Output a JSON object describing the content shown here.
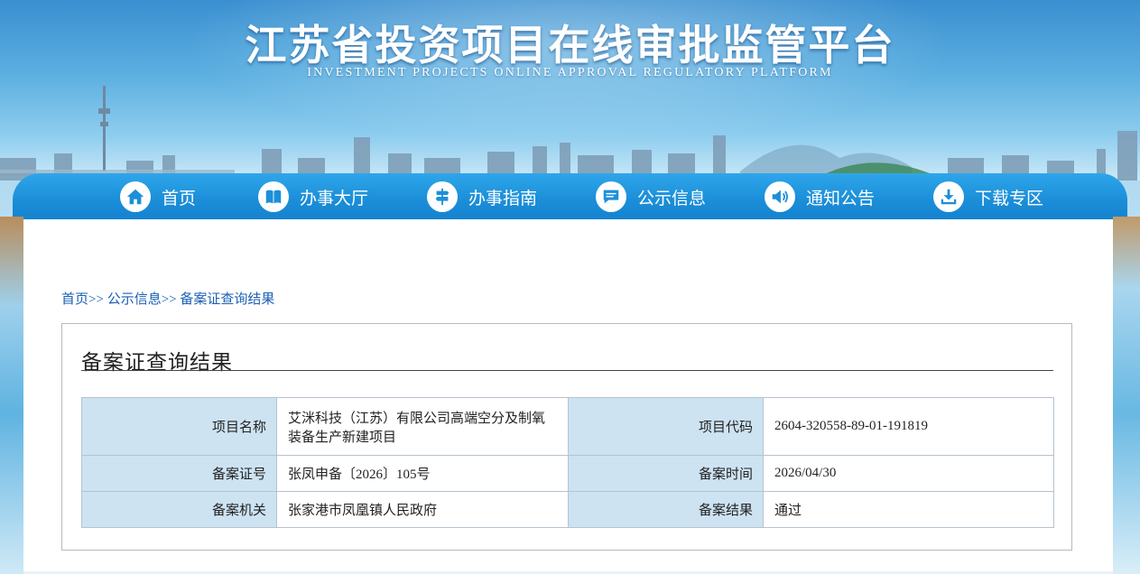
{
  "header": {
    "title": "江苏省投资项目在线审批监管平台",
    "subtitle": "INVESTMENT PROJECTS ONLINE APPROVAL REGULATORY PLATFORM"
  },
  "nav": {
    "items": [
      {
        "label": "首页",
        "icon": "home-icon"
      },
      {
        "label": "办事大厅",
        "icon": "book-icon"
      },
      {
        "label": "办事指南",
        "icon": "signpost-icon"
      },
      {
        "label": "公示信息",
        "icon": "message-icon"
      },
      {
        "label": "通知公告",
        "icon": "speaker-icon"
      },
      {
        "label": "下载专区",
        "icon": "download-icon"
      }
    ]
  },
  "breadcrumb": {
    "home": "首页",
    "sep1": ">>",
    "section": "公示信息",
    "sep2": ">>",
    "current": "备案证查询结果"
  },
  "panel": {
    "title": "备案证查询结果"
  },
  "record": {
    "project_name_label": "项目名称",
    "project_name_line1": "艾洣科技（江苏）有限公司高端空分及制氧",
    "project_name_line2": "装备生产新建项目",
    "project_code_label": "项目代码",
    "project_code": "2604-320558-89-01-191819",
    "cert_no_label": "备案证号",
    "cert_no": "张凤申备〔2026〕105号",
    "filing_date_label": "备案时间",
    "filing_date": "2026/04/30",
    "authority_label": "备案机关",
    "authority": "张家港市凤凰镇人民政府",
    "result_label": "备案结果",
    "result": "通过"
  },
  "colors": {
    "nav_blue": "#1c8fd9",
    "label_cell_bg": "#cde3f2",
    "link_blue": "#1a5fb4"
  }
}
